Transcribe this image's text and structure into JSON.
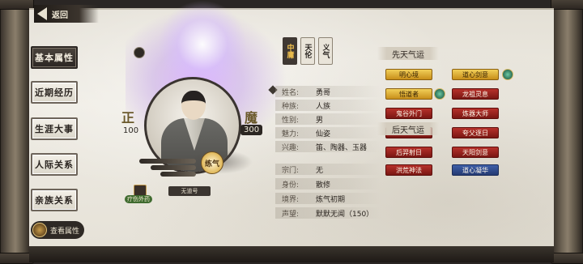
{
  "back": {
    "label": "返回"
  },
  "tabs": [
    {
      "label": "基本属性",
      "active": true
    },
    {
      "label": "近期经历",
      "active": false
    },
    {
      "label": "生涯大事",
      "active": false
    },
    {
      "label": "人际关系",
      "active": false
    },
    {
      "label": "亲族关系",
      "active": false
    }
  ],
  "view_attr": {
    "label": "查看属性"
  },
  "character": {
    "left_glyph": "正",
    "left_value": "100",
    "right_glyph": "魔",
    "right_value": "300",
    "seal_text": "练气",
    "item_label": "疗伤外药",
    "title_label": "无道号"
  },
  "vertical_tabs": [
    "中庸",
    "天伦",
    "义气"
  ],
  "info": [
    {
      "label": "姓名:",
      "value": "勇哥"
    },
    {
      "label": "种族:",
      "value": "人族"
    },
    {
      "label": "性别:",
      "value": "男"
    },
    {
      "label": "魅力:",
      "value": "仙姿"
    },
    {
      "label": "兴趣:",
      "value": "笛、陶器、玉器"
    },
    {
      "label": "宗门:",
      "value": "无"
    },
    {
      "label": "身份:",
      "value": "散修"
    },
    {
      "label": "境界:",
      "value": "炼气初期"
    },
    {
      "label": "声望:",
      "value": "默默无闻（150）"
    }
  ],
  "fortune": {
    "innate_title": "先天气运",
    "acquired_title": "后天气运",
    "innate": [
      {
        "label": "明心境",
        "style": "gold"
      },
      {
        "label": "道心剑意",
        "style": "gold"
      },
      {
        "label": "悟道者",
        "style": "gold"
      },
      {
        "label": "龙祖灵息",
        "style": "red"
      },
      {
        "label": "鬼谷外门",
        "style": "red"
      },
      {
        "label": "炼器大师",
        "style": "red"
      },
      {
        "label": "",
        "style": "red"
      },
      {
        "label": "夸父逐日",
        "style": "red"
      }
    ],
    "acquired": [
      {
        "label": "后羿射日",
        "style": "red"
      },
      {
        "label": "天阳剑意",
        "style": "red"
      },
      {
        "label": "洪荒神法",
        "style": "red"
      },
      {
        "label": "道心凝华",
        "style": "blue"
      }
    ]
  }
}
